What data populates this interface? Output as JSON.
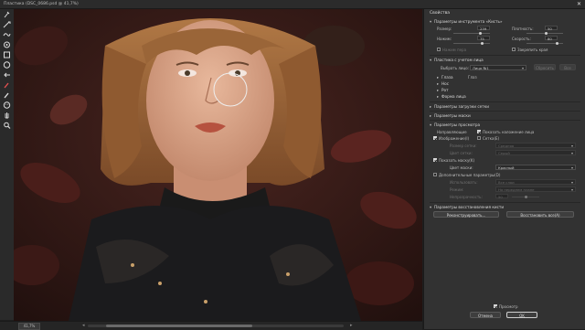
{
  "window": {
    "title": "Пластика (DSC_0686.psd @ 41,7%)",
    "close_glyph": "✕"
  },
  "toolbar": {
    "tools": [
      "forward-warp-icon",
      "reconstruct-icon",
      "smooth-icon",
      "twirl-icon",
      "pucker-icon",
      "bloat-icon",
      "push-left-icon",
      "freeze-mask-icon",
      "thaw-mask-icon",
      "face-tool-icon",
      "hand-icon",
      "zoom-icon"
    ]
  },
  "status": {
    "zoom": "41,7%"
  },
  "panel": {
    "title": "Свойства",
    "brush_section": "Параметры инструмента «Кисть»",
    "size_label": "Размер:",
    "size_value": "239",
    "density_label": "Плотность:",
    "density_value": "50",
    "pressure_label": "Нажим:",
    "pressure_value": "75",
    "rate_label": "Скорость:",
    "rate_value": "80",
    "stylus_label": "Нажим пера",
    "pin_edges_label": "Закрепить края",
    "face_section": "Пластика с учетом лица",
    "select_face_label": "Выбрать лицо:",
    "select_face_value": "Лицо №1",
    "reset_label": "Сбросить",
    "all_label": "Все",
    "eyes_label": "Глаза",
    "eyes_link": "Глаз",
    "nose_label": "Нос",
    "mouth_label": "Рот",
    "face_shape_label": "Форма лица",
    "load_mesh_section": "Параметры загрузки сетки",
    "mask_section": "Параметры маски",
    "view_section": "Параметры просмотра",
    "guides_label": "Направляющие",
    "face_overlay_label": "Показать наложение лица",
    "image_label": "Изображение(I)",
    "mesh_label": "Сетка(E)",
    "mesh_size_label": "Размер сетки:",
    "mesh_size_value": "Средняя",
    "mesh_color_label": "Цвет сетки:",
    "mesh_color_value": "Серый",
    "show_mask_label": "Показать маску(K)",
    "mask_color_label": "Цвет маски:",
    "mask_color_value": "Красный",
    "backdrop_section": "Дополнительные параметры(D)",
    "use_label": "Использовать:",
    "use_value": "Все слои",
    "mode_label": "Режим:",
    "mode_value": "На переднем плане",
    "opacity_label": "Непрозрачность:",
    "opacity_value": "50",
    "reconstruct_section": "Параметры восстановления кисти",
    "reconstruct_button": "Реконструировать...",
    "restore_all_button": "Восстановить все(A)",
    "preview_label": "Просмотр",
    "cancel_button": "Отмена",
    "ok_button": "OK"
  }
}
